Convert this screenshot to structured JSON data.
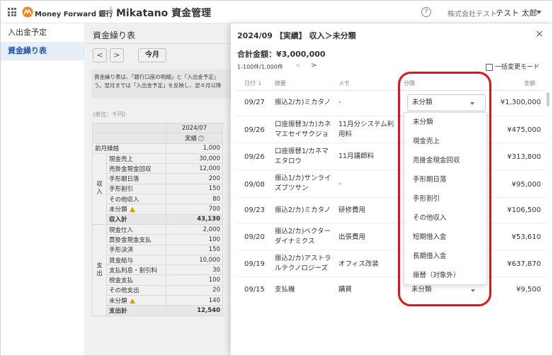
{
  "header": {
    "brand": "Money Forward 銀行",
    "product": "Mikatano 資金管理",
    "help": "?",
    "company": "株式会社テスト",
    "user": "テスト 太郎"
  },
  "sidebar": {
    "items": [
      {
        "label": "入出金予定"
      },
      {
        "label": "資金繰り表"
      }
    ]
  },
  "main": {
    "title": "資金繰り表",
    "prev": "<",
    "next": ">",
    "today": "今月",
    "desc_line1": "資金繰り表は、「銀行口座の明細」と「入出金予定」",
    "desc_line2": "う。翌月までは「入出金予定」を反映し、翌々月以降",
    "unit": "(単位：千円)",
    "col_month": "2024/07",
    "col_kind": "実績",
    "group_in": "収入",
    "group_out": "支出",
    "rows_top": [
      {
        "label": "前月繰越",
        "value": "1,000"
      }
    ],
    "rows_in": [
      {
        "label": "現金売上",
        "value": "30,000"
      },
      {
        "label": "売掛金現金回収",
        "value": "12,000"
      },
      {
        "label": "手形期日落",
        "value": "200"
      },
      {
        "label": "手形割引",
        "value": "150"
      },
      {
        "label": "その他収入",
        "value": "80"
      },
      {
        "label": "未分類",
        "value": "700"
      }
    ],
    "total_in": {
      "label": "収入計",
      "value": "43,130"
    },
    "rows_out": [
      {
        "label": "現金仕入",
        "value": "2,000"
      },
      {
        "label": "買掛金現金支払",
        "value": "100"
      },
      {
        "label": "手形決済",
        "value": "150"
      },
      {
        "label": "賃金給与",
        "value": "10,000"
      },
      {
        "label": "支払利息・割引料",
        "value": "30"
      },
      {
        "label": "税金支払",
        "value": "100"
      },
      {
        "label": "その他支出",
        "value": "20"
      },
      {
        "label": "未分類",
        "value": "140"
      }
    ],
    "total_out": {
      "label": "支出計",
      "value": "12,540"
    }
  },
  "panel": {
    "title": "2024/09 【実績】 収入＞未分類",
    "close": "×",
    "total": "合計金額：¥3,000,000",
    "range": "1-100件/1,000件",
    "prev": "<",
    "next": ">",
    "bulk_mode": "一括変更モード",
    "col_date": "日付 ↓",
    "col_desc": "摘要",
    "col_memo": "メモ",
    "col_cat": "分類",
    "col_amount": "金額",
    "selected_category": "未分類",
    "rows": [
      {
        "date": "09/27",
        "desc": "振込2/カ)ミカタノ",
        "memo": "-",
        "amount": "¥1,300,000"
      },
      {
        "date": "09/26",
        "desc": "口座振替3/カ)カネ\nマエセイサクジョ",
        "memo": "11月分システム利\n用料",
        "amount": "¥475,000"
      },
      {
        "date": "09/26",
        "desc": "口座振替1/カネマ\nエタロウ",
        "memo": "11月講師料",
        "amount": "¥313,800"
      },
      {
        "date": "09/08",
        "desc": "振込1/カ)サンライ\nズブツサン",
        "memo": "-",
        "amount": "¥95,000"
      },
      {
        "date": "09/23",
        "desc": "振込2/カ)ミカタノ",
        "memo": "研修費用",
        "amount": "¥106,500"
      },
      {
        "date": "09/20",
        "desc": "振込2/カ)ベクター\nダイナミクス",
        "memo": "出張費用",
        "amount": "¥53,610"
      },
      {
        "date": "09/19",
        "desc": "振込2/カ)アストラ\nルテクノロジーズ",
        "memo": "オフィス改装",
        "amount": "¥637,870"
      },
      {
        "date": "09/15",
        "desc": "支払機",
        "memo": "購買",
        "amount": "¥9,500",
        "category": "未分類"
      }
    ],
    "menu": [
      "未分類",
      "現金売上",
      "売掛金現金回収",
      "手形期日落",
      "手形割引",
      "その他収入",
      "短期借入金",
      "長期借入金",
      "振替（対象外）"
    ]
  }
}
